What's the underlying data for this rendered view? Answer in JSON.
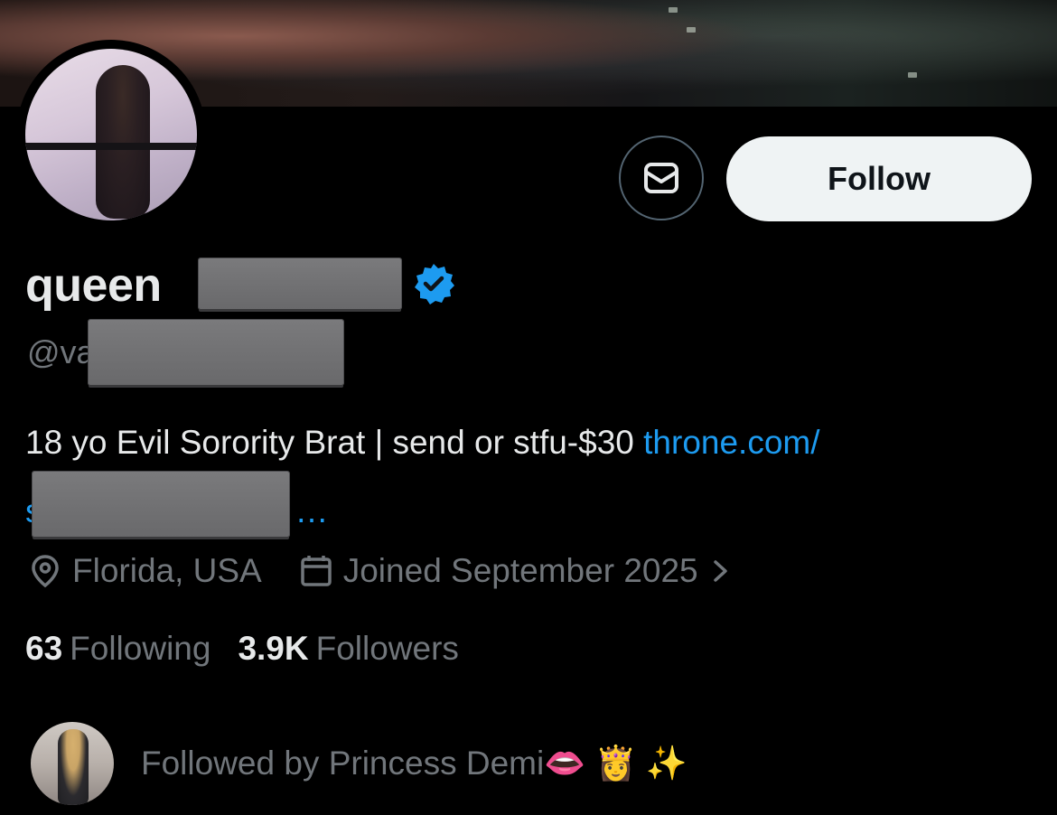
{
  "profile": {
    "display_name": "queen",
    "handle": "@va",
    "bio_text": "18 yo Evil Sorority Brat | send or stfu-$30 ",
    "bio_link": "throne.com/",
    "bio_link_cont": "s",
    "bio_ellipsis": "…",
    "location": "Florida, USA",
    "joined": "Joined September 2025",
    "following_count": "63",
    "following_label": "Following",
    "followers_count": "3.9K",
    "followers_label": "Followers",
    "followed_by": "Followed by Princess Demi👄 👸 ✨"
  },
  "actions": {
    "follow_label": "Follow"
  },
  "colors": {
    "background": "#000000",
    "primary_text": "#e7e9ea",
    "secondary_text": "#71767b",
    "link": "#1d9bf0",
    "verified": "#1d9bf0",
    "follow_button_bg": "#eff3f4"
  },
  "icons": {
    "message": "envelope-icon",
    "verified": "verified-badge-icon",
    "location": "location-pin-icon",
    "calendar": "calendar-icon",
    "chevron": "chevron-right-icon"
  }
}
